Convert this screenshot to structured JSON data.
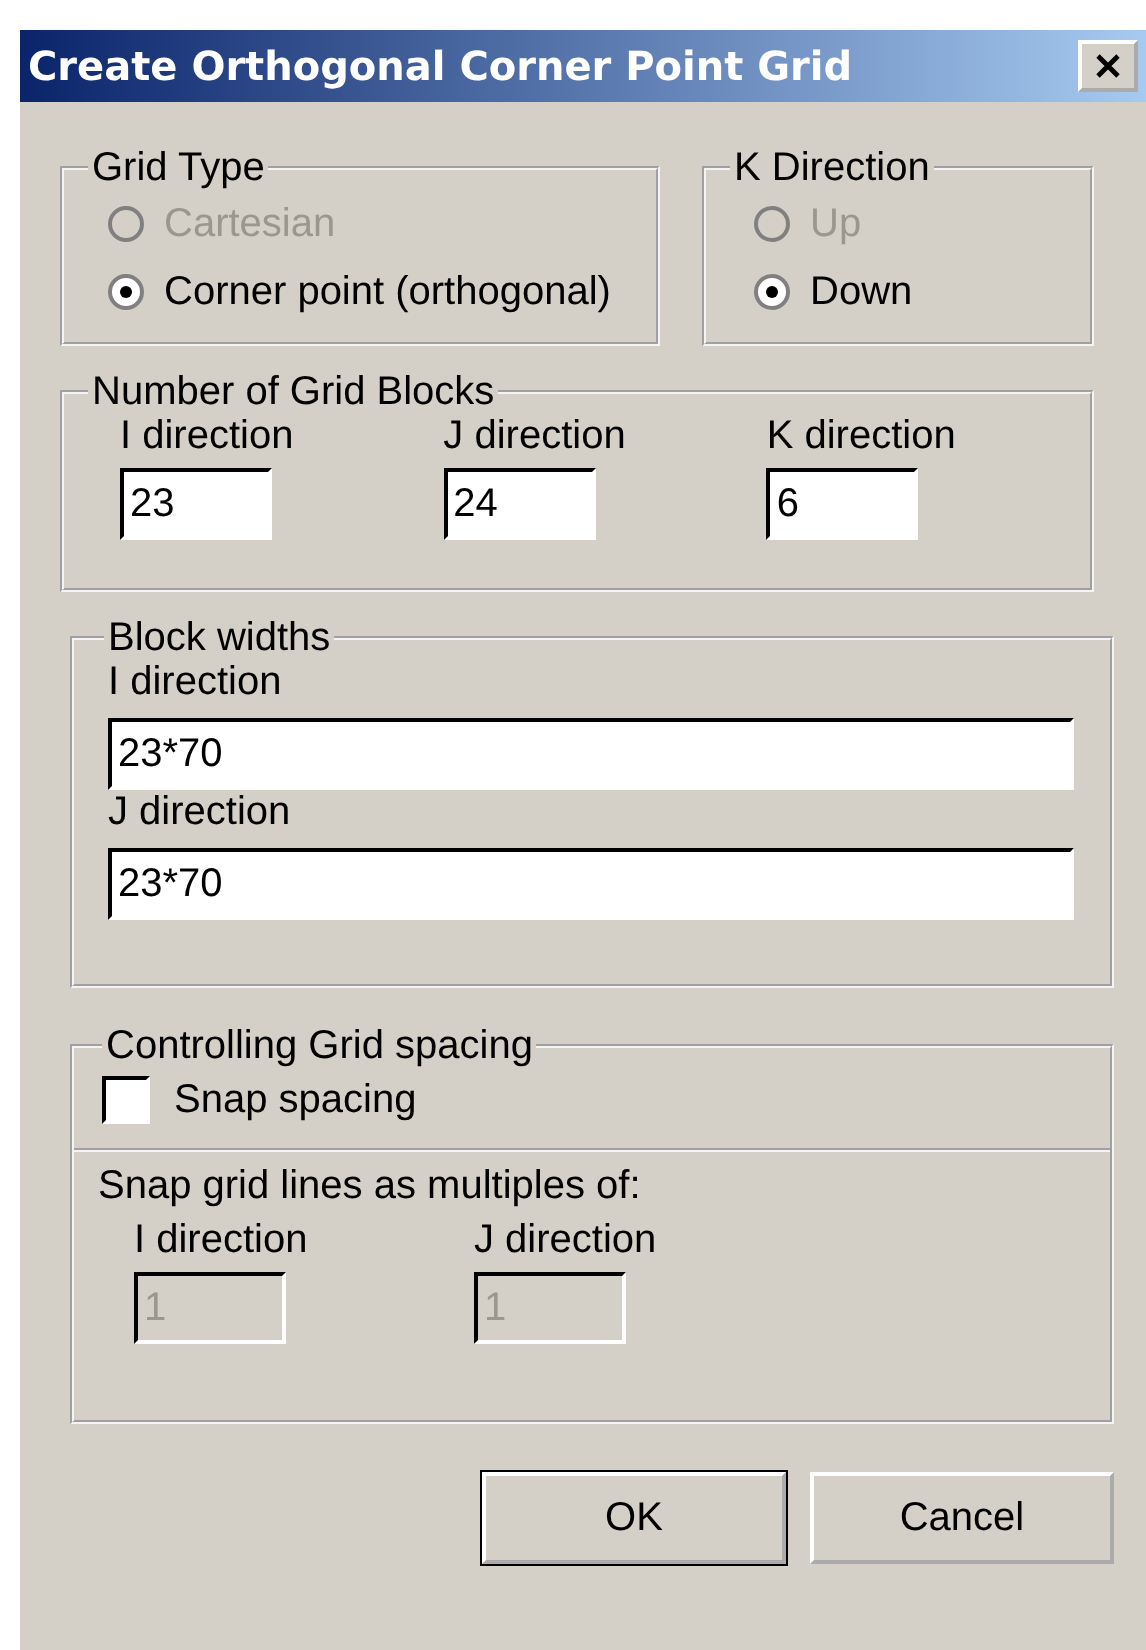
{
  "window": {
    "title": "Create Orthogonal Corner Point Grid"
  },
  "grid_type": {
    "label": "Grid Type",
    "options": [
      {
        "label": "Cartesian",
        "selected": false,
        "disabled": true
      },
      {
        "label": "Corner point (orthogonal)",
        "selected": true,
        "disabled": false
      }
    ]
  },
  "k_direction": {
    "label": "K Direction",
    "options": [
      {
        "label": "Up",
        "selected": false,
        "disabled": true
      },
      {
        "label": "Down",
        "selected": true,
        "disabled": false
      }
    ]
  },
  "grid_blocks": {
    "label": "Number of Grid Blocks",
    "fields": [
      {
        "label": "I direction",
        "value": "23"
      },
      {
        "label": "J direction",
        "value": "24"
      },
      {
        "label": "K direction",
        "value": "6"
      }
    ]
  },
  "block_widths": {
    "label": "Block widths",
    "fields": [
      {
        "label": "I direction",
        "value": "23*70"
      },
      {
        "label": "J direction",
        "value": "23*70"
      }
    ]
  },
  "controlling": {
    "label": "Controlling Grid spacing",
    "snap": {
      "label": "Snap spacing",
      "checked": false
    },
    "multiples": {
      "label": "Snap grid lines as multiples of:",
      "fields": [
        {
          "label": "I direction",
          "value": "1",
          "disabled": true
        },
        {
          "label": "J direction",
          "value": "1",
          "disabled": true
        }
      ]
    }
  },
  "buttons": [
    {
      "label": "OK",
      "default": true
    },
    {
      "label": "Cancel",
      "default": false
    }
  ]
}
